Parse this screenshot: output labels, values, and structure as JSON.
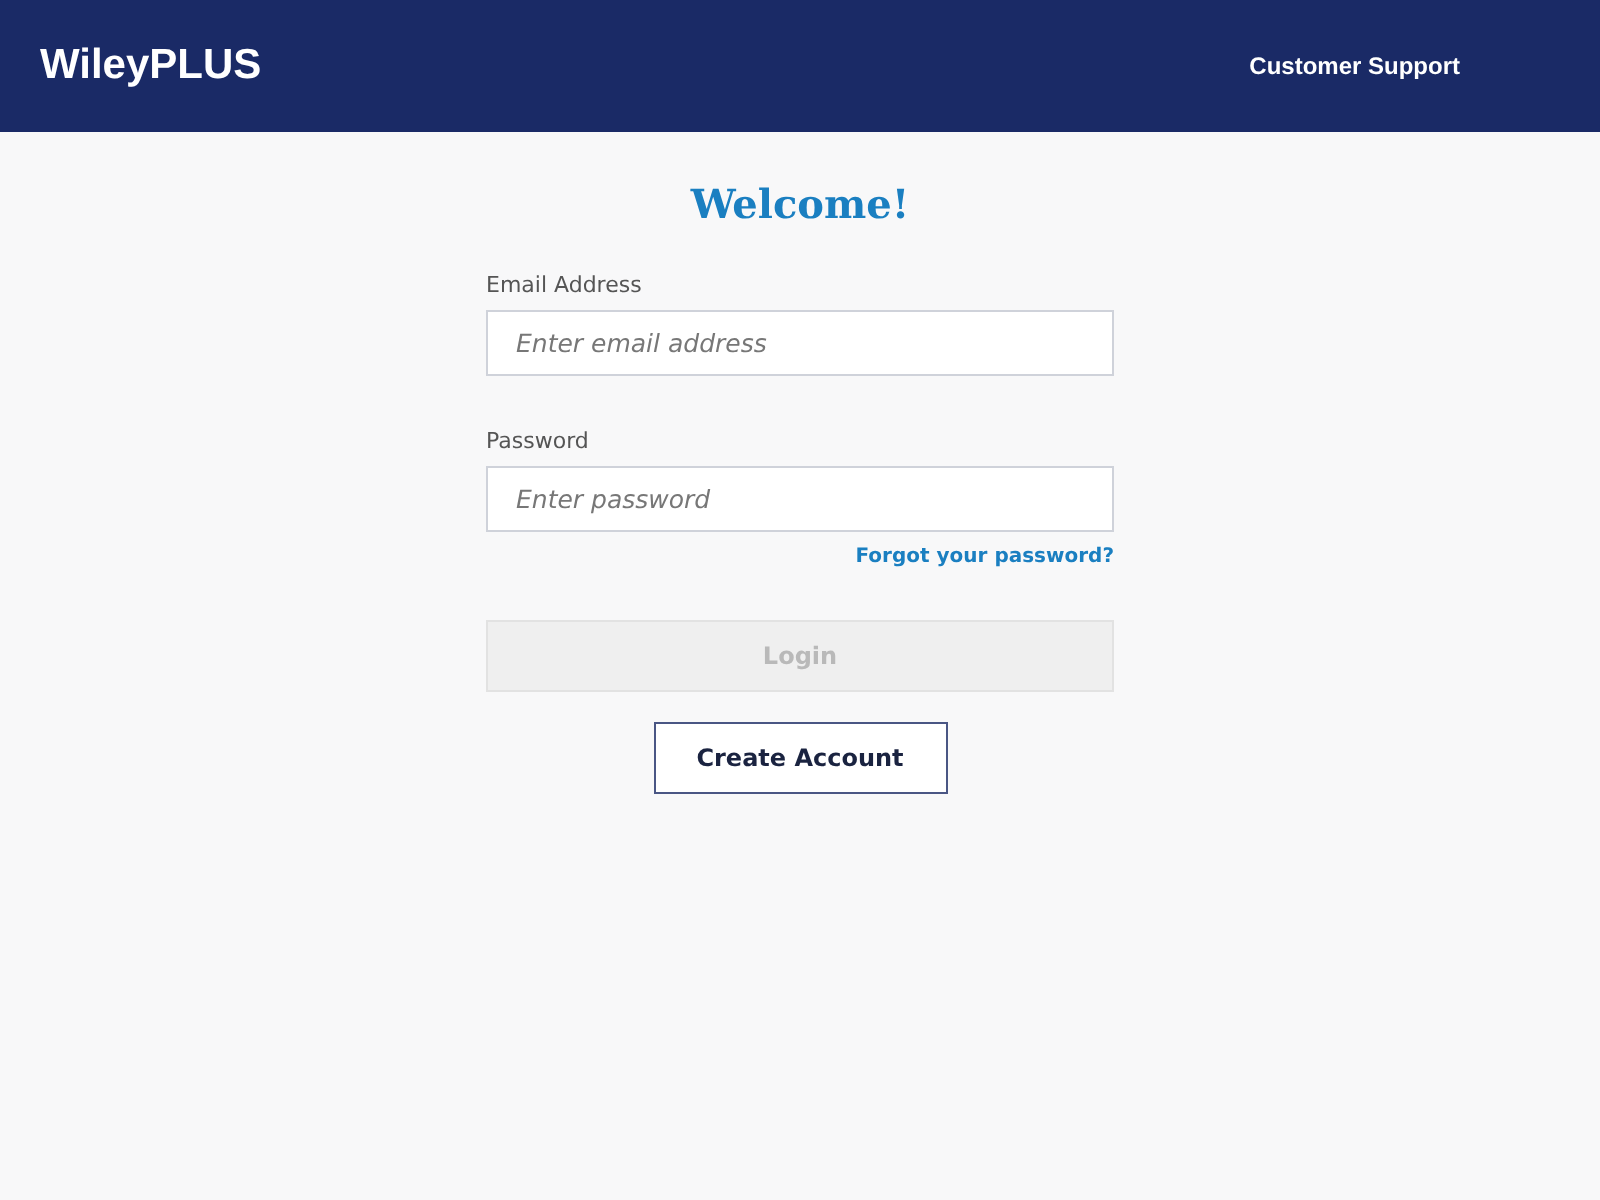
{
  "header": {
    "logo": "WileyPLUS",
    "link": "Customer Support"
  },
  "title": "Welcome!",
  "fields": [
    {
      "label": "Email Address",
      "placeholder": "Enter email address"
    },
    {
      "label": "Password",
      "placeholder": "Enter password"
    }
  ],
  "forgot_link": "Forgot your password?",
  "login_button": {
    "label": "Login",
    "disabled": true
  },
  "create_button": "Create Account"
}
